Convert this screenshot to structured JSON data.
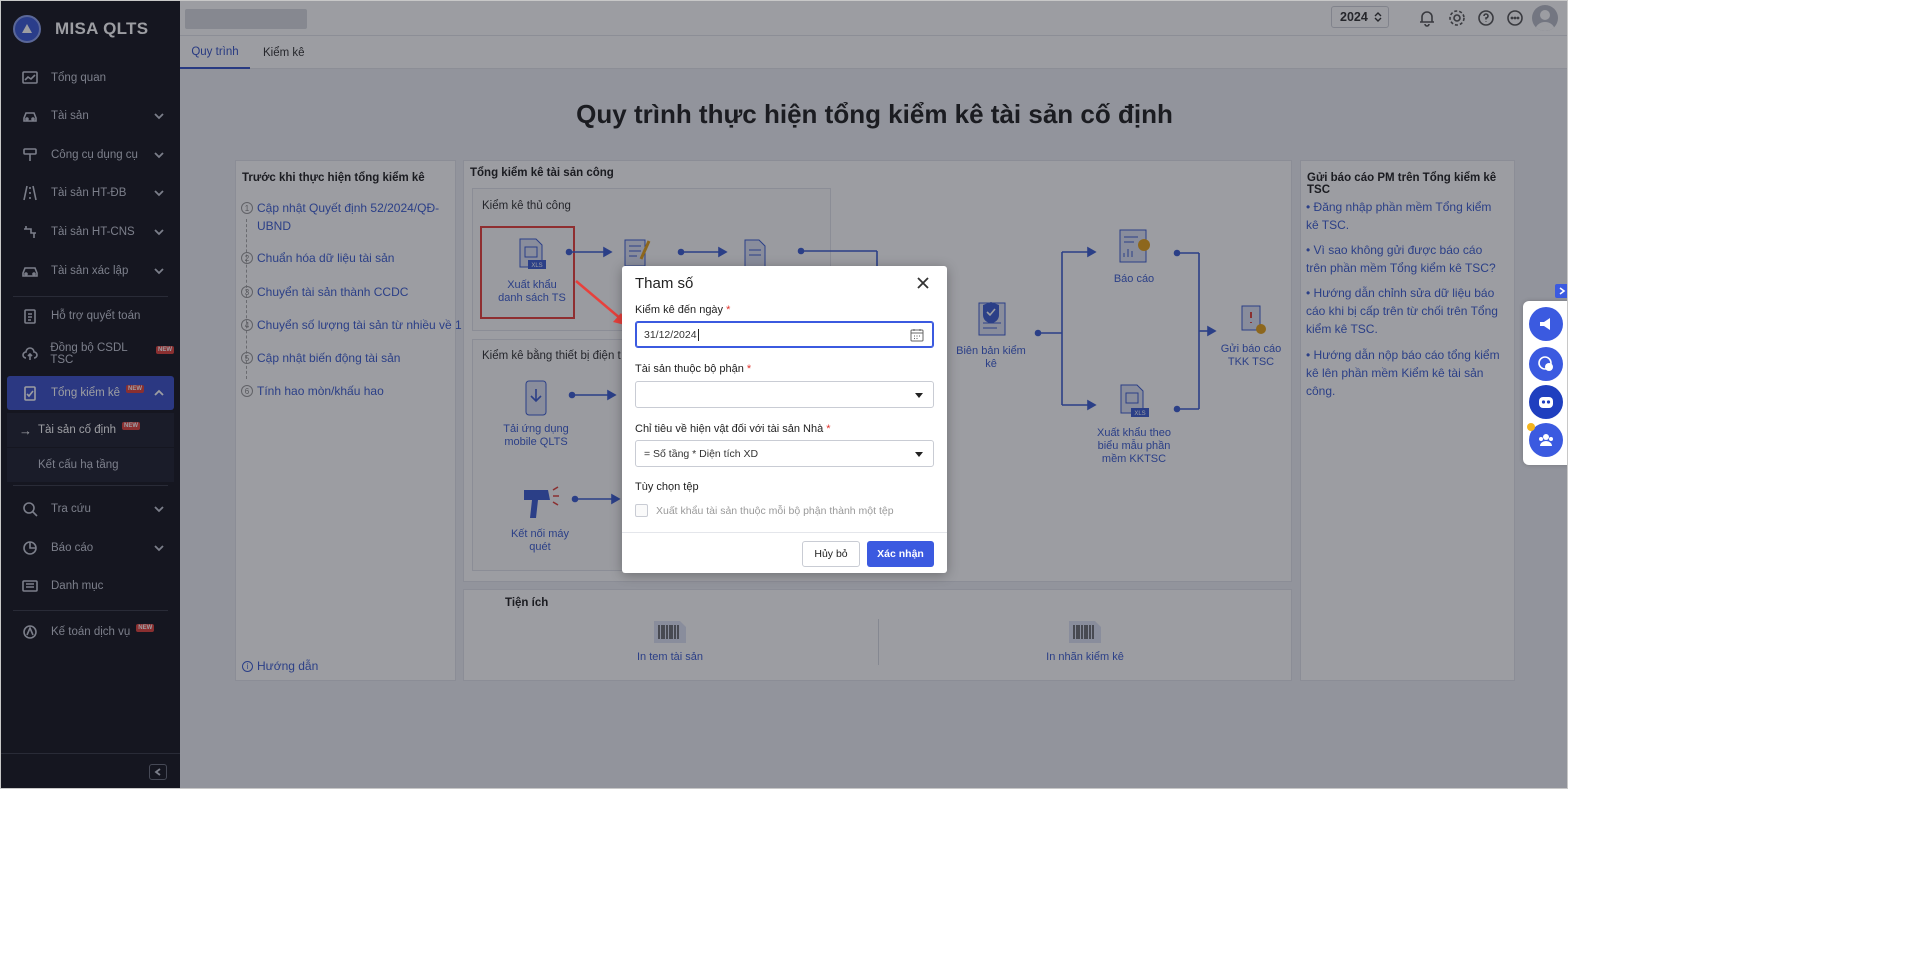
{
  "brand": {
    "name": "MISA QLTS"
  },
  "sidebar": {
    "items": [
      {
        "label": "Tổng quan",
        "icon": "dashboard-icon",
        "chevron": false
      },
      {
        "label": "Tài sản",
        "icon": "car-asset-icon",
        "chevron": true
      },
      {
        "label": "Công cụ dụng cụ",
        "icon": "tool-icon",
        "chevron": true
      },
      {
        "label": "Tài sản HT-ĐB",
        "icon": "road-icon",
        "chevron": true
      },
      {
        "label": "Tài sản HT-CNS",
        "icon": "water-icon",
        "chevron": true
      },
      {
        "label": "Tài sản xác lập",
        "icon": "car-icon",
        "chevron": true
      },
      {
        "label": "Hỗ trợ quyết toán",
        "icon": "clipboard-icon",
        "chevron": false
      },
      {
        "label": "Đồng bộ CSDL TSC",
        "icon": "cloud-sync-icon",
        "chevron": false,
        "badge": "NEW"
      },
      {
        "label": "Tổng kiểm kê",
        "icon": "checklist-icon",
        "chevron": true,
        "badge": "NEW",
        "active": true
      },
      {
        "label": "Tra cứu",
        "icon": "search-icon",
        "chevron": true
      },
      {
        "label": "Báo cáo",
        "icon": "chart-icon",
        "chevron": true
      },
      {
        "label": "Danh mục",
        "icon": "list-icon",
        "chevron": false
      },
      {
        "label": "Kế toán dịch vụ",
        "icon": "accounting-icon",
        "chevron": false,
        "badge": "NEW"
      }
    ],
    "subitems": [
      {
        "label": "Tài sản cố định",
        "badge": "NEW",
        "current": true
      },
      {
        "label": "Kết cấu hạ tầng"
      }
    ]
  },
  "topbar": {
    "year": "2024"
  },
  "tabs": [
    {
      "label": "Quy trình",
      "active": true
    },
    {
      "label": "Kiểm kê"
    }
  ],
  "main": {
    "title": "Quy trình thực hiện tổng kiểm kê tài sản cố định",
    "before": {
      "heading": "Trước khi thực hiện tổng kiểm kê",
      "steps": [
        {
          "num": "1",
          "text": "Cập nhật Quyết định 52/2024/QĐ-UBND"
        },
        {
          "num": "2",
          "text": "Chuẩn hóa dữ liệu tài sản"
        },
        {
          "num": "3",
          "text": "Chuyển tài sản thành CCDC"
        },
        {
          "num": "4",
          "text": "Chuyển số lượng tài sản từ nhiều về 1"
        },
        {
          "num": "5",
          "text": "Cập nhật biến động tài sản"
        },
        {
          "num": "6",
          "text": "Tính hao mòn/khấu hao"
        }
      ],
      "guide": "Hướng dẫn"
    },
    "center": {
      "heading": "Tổng kiểm kê tài sản công",
      "manual": "Kiểm kê thủ công",
      "device": "Kiểm kê bằng thiết bị điện t",
      "export": "Xuất khẩu danh sách TS",
      "mobile": "Tải ứng dụng mobile QLTS",
      "scanner": "Kết nối máy quét",
      "minutes": "Biên bản kiểm kê",
      "report": "Báo cáo",
      "export_form": "Xuất khẩu theo biểu mẫu phần mềm KKTSC",
      "send": "Gửi báo cáo TKK TSC"
    },
    "utilities": {
      "heading": "Tiện ích",
      "print_tag": "In tem tài sản",
      "print_label": "In nhãn kiểm kê"
    },
    "send_panel": {
      "heading": "Gửi báo cáo PM trên Tổng kiểm kê TSC",
      "links": [
        "• Đăng nhập phần mềm Tổng kiểm kê TSC.",
        "• Vì sao không gửi được báo cáo trên phần mềm Tổng kiểm kê TSC?",
        "• Hướng dẫn chỉnh sửa dữ liệu báo cáo khi bị cấp trên từ chối trên Tổng kiểm kê TSC.",
        "• Hướng dẫn nộp báo cáo tổng kiểm kê lên phần mềm Kiểm kê tài sản công."
      ]
    }
  },
  "dialog": {
    "title": "Tham số",
    "date_label": "Kiểm kê đến ngày",
    "date_value": "31/12/2024",
    "dept_label": "Tài sản thuộc bộ phận",
    "dept_value": "",
    "criteria_label": "Chỉ tiêu về hiện vật đối với tài sản Nhà",
    "criteria_value": "= Số tầng * Diện tích XD",
    "file_option_label": "Tùy chọn tệp",
    "file_option_check": "Xuất khẩu tài sản thuộc mỗi bộ phận thành một tệp",
    "file_option_checked": false,
    "cancel": "Hủy bỏ",
    "confirm": "Xác nhận",
    "required_mark": "*"
  },
  "colors": {
    "accent": "#3b5ae0",
    "sidebar_bg": "#17181f",
    "highlight": "#e8413c"
  }
}
